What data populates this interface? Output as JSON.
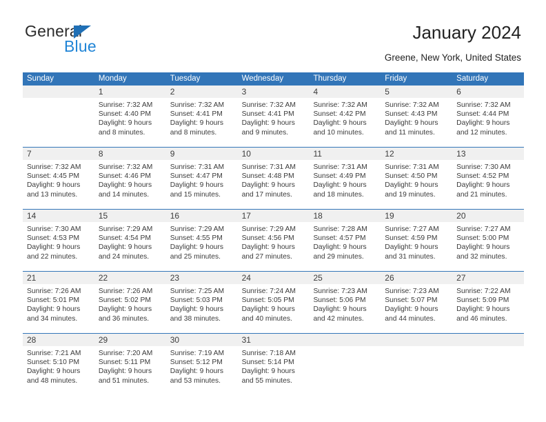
{
  "brand": {
    "word_one": "General",
    "word_two": "Blue",
    "triangle_color": "#1F6FB5",
    "blue_text_color": "#1F84D6"
  },
  "header": {
    "title": "January 2024",
    "subtitle": "Greene, New York, United States",
    "accent_color": "#3275B8",
    "date_strip_color": "#F0F0F0"
  },
  "calendar": {
    "day_names": [
      "Sunday",
      "Monday",
      "Tuesday",
      "Wednesday",
      "Thursday",
      "Friday",
      "Saturday"
    ],
    "weeks": [
      [
        {
          "day": "",
          "lines": []
        },
        {
          "day": "1",
          "lines": [
            "Sunrise: 7:32 AM",
            "Sunset: 4:40 PM",
            "Daylight: 9 hours",
            "and 8 minutes."
          ]
        },
        {
          "day": "2",
          "lines": [
            "Sunrise: 7:32 AM",
            "Sunset: 4:41 PM",
            "Daylight: 9 hours",
            "and 8 minutes."
          ]
        },
        {
          "day": "3",
          "lines": [
            "Sunrise: 7:32 AM",
            "Sunset: 4:41 PM",
            "Daylight: 9 hours",
            "and 9 minutes."
          ]
        },
        {
          "day": "4",
          "lines": [
            "Sunrise: 7:32 AM",
            "Sunset: 4:42 PM",
            "Daylight: 9 hours",
            "and 10 minutes."
          ]
        },
        {
          "day": "5",
          "lines": [
            "Sunrise: 7:32 AM",
            "Sunset: 4:43 PM",
            "Daylight: 9 hours",
            "and 11 minutes."
          ]
        },
        {
          "day": "6",
          "lines": [
            "Sunrise: 7:32 AM",
            "Sunset: 4:44 PM",
            "Daylight: 9 hours",
            "and 12 minutes."
          ]
        }
      ],
      [
        {
          "day": "7",
          "lines": [
            "Sunrise: 7:32 AM",
            "Sunset: 4:45 PM",
            "Daylight: 9 hours",
            "and 13 minutes."
          ]
        },
        {
          "day": "8",
          "lines": [
            "Sunrise: 7:32 AM",
            "Sunset: 4:46 PM",
            "Daylight: 9 hours",
            "and 14 minutes."
          ]
        },
        {
          "day": "9",
          "lines": [
            "Sunrise: 7:31 AM",
            "Sunset: 4:47 PM",
            "Daylight: 9 hours",
            "and 15 minutes."
          ]
        },
        {
          "day": "10",
          "lines": [
            "Sunrise: 7:31 AM",
            "Sunset: 4:48 PM",
            "Daylight: 9 hours",
            "and 17 minutes."
          ]
        },
        {
          "day": "11",
          "lines": [
            "Sunrise: 7:31 AM",
            "Sunset: 4:49 PM",
            "Daylight: 9 hours",
            "and 18 minutes."
          ]
        },
        {
          "day": "12",
          "lines": [
            "Sunrise: 7:31 AM",
            "Sunset: 4:50 PM",
            "Daylight: 9 hours",
            "and 19 minutes."
          ]
        },
        {
          "day": "13",
          "lines": [
            "Sunrise: 7:30 AM",
            "Sunset: 4:52 PM",
            "Daylight: 9 hours",
            "and 21 minutes."
          ]
        }
      ],
      [
        {
          "day": "14",
          "lines": [
            "Sunrise: 7:30 AM",
            "Sunset: 4:53 PM",
            "Daylight: 9 hours",
            "and 22 minutes."
          ]
        },
        {
          "day": "15",
          "lines": [
            "Sunrise: 7:29 AM",
            "Sunset: 4:54 PM",
            "Daylight: 9 hours",
            "and 24 minutes."
          ]
        },
        {
          "day": "16",
          "lines": [
            "Sunrise: 7:29 AM",
            "Sunset: 4:55 PM",
            "Daylight: 9 hours",
            "and 25 minutes."
          ]
        },
        {
          "day": "17",
          "lines": [
            "Sunrise: 7:29 AM",
            "Sunset: 4:56 PM",
            "Daylight: 9 hours",
            "and 27 minutes."
          ]
        },
        {
          "day": "18",
          "lines": [
            "Sunrise: 7:28 AM",
            "Sunset: 4:57 PM",
            "Daylight: 9 hours",
            "and 29 minutes."
          ]
        },
        {
          "day": "19",
          "lines": [
            "Sunrise: 7:27 AM",
            "Sunset: 4:59 PM",
            "Daylight: 9 hours",
            "and 31 minutes."
          ]
        },
        {
          "day": "20",
          "lines": [
            "Sunrise: 7:27 AM",
            "Sunset: 5:00 PM",
            "Daylight: 9 hours",
            "and 32 minutes."
          ]
        }
      ],
      [
        {
          "day": "21",
          "lines": [
            "Sunrise: 7:26 AM",
            "Sunset: 5:01 PM",
            "Daylight: 9 hours",
            "and 34 minutes."
          ]
        },
        {
          "day": "22",
          "lines": [
            "Sunrise: 7:26 AM",
            "Sunset: 5:02 PM",
            "Daylight: 9 hours",
            "and 36 minutes."
          ]
        },
        {
          "day": "23",
          "lines": [
            "Sunrise: 7:25 AM",
            "Sunset: 5:03 PM",
            "Daylight: 9 hours",
            "and 38 minutes."
          ]
        },
        {
          "day": "24",
          "lines": [
            "Sunrise: 7:24 AM",
            "Sunset: 5:05 PM",
            "Daylight: 9 hours",
            "and 40 minutes."
          ]
        },
        {
          "day": "25",
          "lines": [
            "Sunrise: 7:23 AM",
            "Sunset: 5:06 PM",
            "Daylight: 9 hours",
            "and 42 minutes."
          ]
        },
        {
          "day": "26",
          "lines": [
            "Sunrise: 7:23 AM",
            "Sunset: 5:07 PM",
            "Daylight: 9 hours",
            "and 44 minutes."
          ]
        },
        {
          "day": "27",
          "lines": [
            "Sunrise: 7:22 AM",
            "Sunset: 5:09 PM",
            "Daylight: 9 hours",
            "and 46 minutes."
          ]
        }
      ],
      [
        {
          "day": "28",
          "lines": [
            "Sunrise: 7:21 AM",
            "Sunset: 5:10 PM",
            "Daylight: 9 hours",
            "and 48 minutes."
          ]
        },
        {
          "day": "29",
          "lines": [
            "Sunrise: 7:20 AM",
            "Sunset: 5:11 PM",
            "Daylight: 9 hours",
            "and 51 minutes."
          ]
        },
        {
          "day": "30",
          "lines": [
            "Sunrise: 7:19 AM",
            "Sunset: 5:12 PM",
            "Daylight: 9 hours",
            "and 53 minutes."
          ]
        },
        {
          "day": "31",
          "lines": [
            "Sunrise: 7:18 AM",
            "Sunset: 5:14 PM",
            "Daylight: 9 hours",
            "and 55 minutes."
          ]
        },
        {
          "day": "",
          "lines": []
        },
        {
          "day": "",
          "lines": []
        },
        {
          "day": "",
          "lines": []
        }
      ]
    ]
  }
}
